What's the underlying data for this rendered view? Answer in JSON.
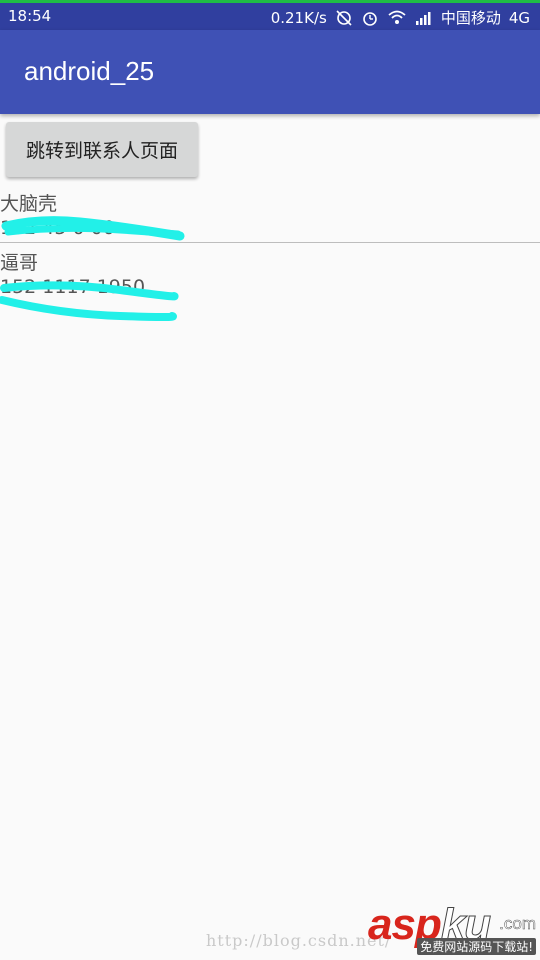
{
  "status_bar": {
    "time": "18:54",
    "speed": "0.21K/s",
    "carrier": "中国移动",
    "network": "4G",
    "icons": [
      "sync-off-icon",
      "alarm-icon",
      "wifi-icon",
      "signal-icon"
    ]
  },
  "app_bar": {
    "title": "android_25"
  },
  "main": {
    "jump_button_label": "跳转到联系人页面",
    "contacts": [
      {
        "name": "大脑壳",
        "phone": "132 45 0 00"
      },
      {
        "name": "逼哥",
        "phone": "152 1117 1950"
      }
    ]
  },
  "watermark": {
    "url": "http://blog.csdn.net/",
    "logo_main": "asp",
    "logo_ku": "ku",
    "logo_dotcom": ".com",
    "logo_sub": "免费网站源码下载站!"
  },
  "colors": {
    "status_bar": "#303f9f",
    "app_bar": "#3f51b5",
    "button": "#d6d7d7",
    "scribble": "#22f0e8",
    "logo_red": "#d8251c"
  }
}
